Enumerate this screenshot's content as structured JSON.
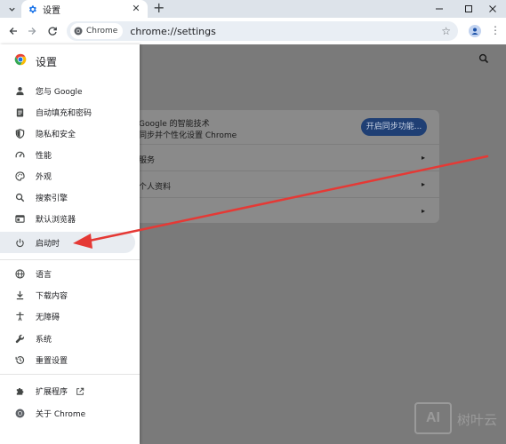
{
  "browser": {
    "tab": {
      "title": "设置"
    },
    "new_tab_label": "+",
    "omnibox": {
      "chip_label": "Chrome",
      "url": "chrome://settings"
    }
  },
  "drawer": {
    "title": "设置",
    "items": [
      {
        "label": "您与 Google",
        "icon": "person-icon"
      },
      {
        "label": "自动填充和密码",
        "icon": "clipboard-icon"
      },
      {
        "label": "隐私和安全",
        "icon": "shield-icon"
      },
      {
        "label": "性能",
        "icon": "speedometer-icon"
      },
      {
        "label": "外观",
        "icon": "palette-icon"
      },
      {
        "label": "搜索引擎",
        "icon": "search-icon"
      },
      {
        "label": "默认浏览器",
        "icon": "browser-window-icon"
      },
      {
        "label": "启动时",
        "icon": "power-icon",
        "active": true
      },
      {
        "label": "语言",
        "icon": "globe-icon"
      },
      {
        "label": "下载内容",
        "icon": "download-icon"
      },
      {
        "label": "无障碍",
        "icon": "accessibility-icon"
      },
      {
        "label": "系统",
        "icon": "wrench-icon"
      },
      {
        "label": "重置设置",
        "icon": "history-icon"
      },
      {
        "label": "扩展程序",
        "icon": "puzzle-icon",
        "external": true
      },
      {
        "label": "关于 Chrome",
        "icon": "chrome-icon"
      }
    ]
  },
  "main": {
    "sync_card": {
      "title": "Google 的智能技术",
      "subtitle": "同步并个性化设置 Chrome",
      "button": "开启同步功能...",
      "rows": [
        "服务",
        "个人资料",
        ""
      ]
    }
  },
  "colors": {
    "accent": "#0b57d0",
    "annotation_arrow": "#e53935",
    "overlay": "#7a7a7a"
  },
  "watermark": {
    "logo": "AI",
    "text": "树叶云"
  }
}
